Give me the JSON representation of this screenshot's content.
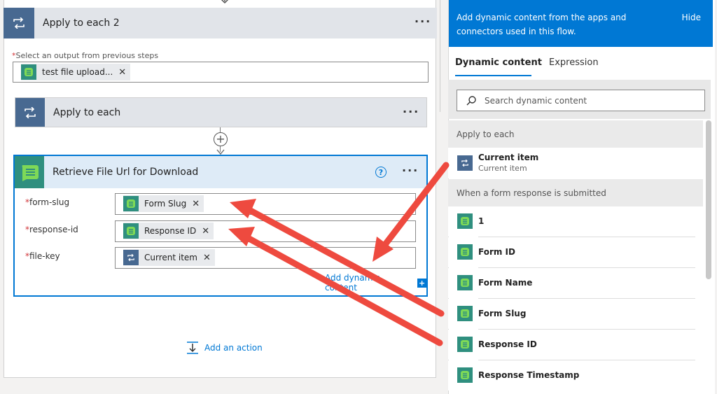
{
  "flow": {
    "apply_each_2": {
      "title": "Apply to each 2",
      "more": "···"
    },
    "select_output": {
      "required": "*",
      "label": "Select an output from previous steps",
      "token": "test file upload...",
      "token_remove": "✕"
    },
    "apply_each": {
      "title": "Apply to each",
      "more": "···"
    },
    "insert_step": "+",
    "retrieve_card": {
      "title": "Retrieve File Url for Download",
      "help": "?",
      "more": "···",
      "fields": [
        {
          "required": "*",
          "label": "form-slug",
          "token": "Form Slug",
          "remove": "✕"
        },
        {
          "required": "*",
          "label": "response-id",
          "token": "Response ID",
          "remove": "✕"
        },
        {
          "required": "*",
          "label": "file-key",
          "token": "Current item",
          "remove": "✕"
        }
      ],
      "add_dynamic": "Add dynamic content",
      "add_dynamic_plus": "+"
    },
    "add_action": "Add an action"
  },
  "panel": {
    "banner": "Add dynamic content from the apps and connectors used in this flow.",
    "hide": "Hide",
    "tabs": [
      "Dynamic content",
      "Expression"
    ],
    "search_placeholder": "Search dynamic content",
    "sections": [
      {
        "heading": "Apply to each",
        "items": [
          {
            "title": "Current item",
            "subtitle": "Current item",
            "icon": "loop-icon"
          }
        ]
      },
      {
        "heading": "When a form response is submitted",
        "items": [
          {
            "title": "1",
            "icon": "forms-icon"
          },
          {
            "title": "Form ID",
            "icon": "forms-icon"
          },
          {
            "title": "Form Name",
            "icon": "forms-icon"
          },
          {
            "title": "Form Slug",
            "icon": "forms-icon"
          },
          {
            "title": "Response ID",
            "icon": "forms-icon"
          },
          {
            "title": "Response Timestamp",
            "icon": "forms-icon"
          }
        ]
      }
    ]
  },
  "colors": {
    "accent": "#0078d4",
    "loop_icon_bg": "#486991",
    "forms_icon_bg": "#2f8f7f",
    "annotation_arrow": "#ee4a3f"
  }
}
